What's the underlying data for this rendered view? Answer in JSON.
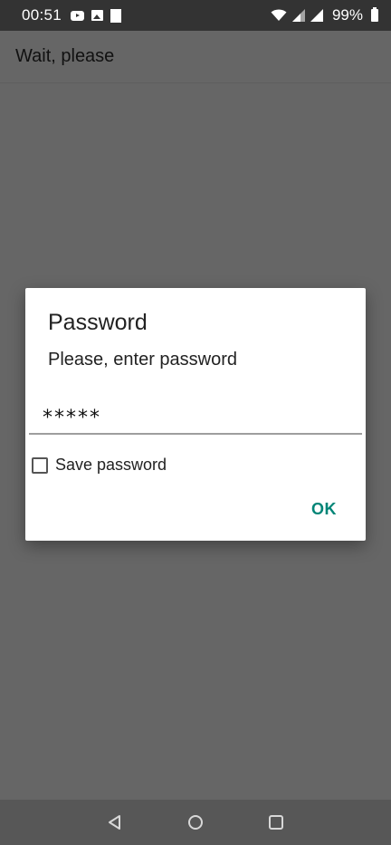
{
  "status_bar": {
    "time": "00:51",
    "battery": "99%",
    "icons": [
      "youtube-icon",
      "image-icon",
      "square-icon",
      "wifi-icon",
      "cell-signal-icon",
      "cell-signal-icon",
      "battery-icon"
    ]
  },
  "app_bar": {
    "title": "Wait, please"
  },
  "dialog": {
    "title": "Password",
    "message": "Please, enter password",
    "password_value": "*****",
    "save_password_label": "Save password",
    "save_password_checked": false,
    "ok_label": "OK",
    "accent_color": "#008577"
  },
  "nav_bar": {
    "icons": [
      "back-icon",
      "home-icon",
      "recents-icon"
    ]
  }
}
